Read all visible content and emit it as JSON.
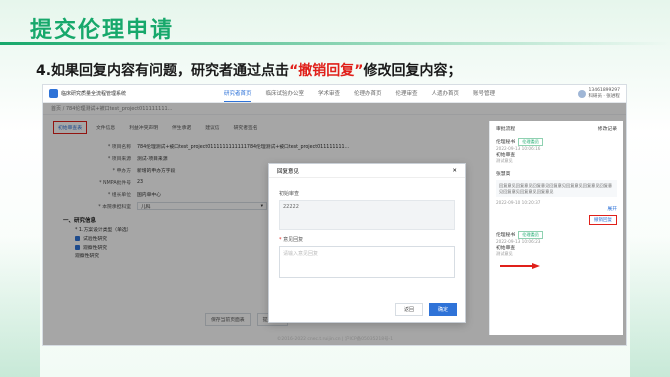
{
  "slide": {
    "title": "提交伦理申请",
    "instruction_prefix": "4.如果回复内容有问题，研究者通过点击",
    "instruction_highlight": "“撤销回复”",
    "instruction_suffix": "修改回复内容；"
  },
  "app": {
    "system_name": "临床研究质量全流程管理系统",
    "nav": [
      "研究者首页",
      "临床试验办公室",
      "学术审查",
      "伦理办首页",
      "伦理审查",
      "人遗办首页",
      "账号管理"
    ],
    "user": {
      "phone": "13461899297",
      "role": "科研员 · 张进程"
    },
    "breadcrumb": "首页 / 784伦理测试+被口test_project011111111...",
    "tabs": [
      "初始审查表",
      "文件信息",
      "利益冲突声明",
      "伴生承诺",
      "建议信",
      "研究者签名"
    ],
    "form": {
      "rows": [
        {
          "label": "* 项目名称",
          "value": "784伦理测试+被口test_project0111111111111784伦理测试+被口test_project011111111..."
        },
        {
          "label": "* 项目来源",
          "value": "测试-项目来源"
        },
        {
          "label": "* 申办方",
          "value": "新增的申办方字段"
        },
        {
          "label": "* NMPA批件号",
          "value": "23"
        },
        {
          "label": "* 组长单位",
          "value": "国内单中心"
        }
      ],
      "select_row": {
        "label": "* 本院承担科室",
        "value": "儿科",
        "second_label": "* 本院"
      },
      "section_title": "一、研究信息",
      "study_type_label": "* 1.方案设计类型（单选）",
      "checkboxes": [
        "试验性研究",
        "观察性研究"
      ],
      "sub_label": "观察性研究"
    },
    "bottom_buttons": [
      "保存当前页面表",
      "提交申请"
    ],
    "right_panel": {
      "title": "审批流程",
      "link": "修改记录",
      "items": [
        {
          "name": "伦理秘书",
          "tag": "伦理委员",
          "time": "2022-09-13 10:06:16",
          "status": "初始审查",
          "note": "测试意见"
        },
        {
          "name": "张慧高",
          "text": "回复意见回复意见回复意见回复意见回复意见回复意见回复意见回复意见回复意见回复意见",
          "time": "2022-09-10 10:20:37",
          "more": "展开"
        },
        {
          "revoke": "撤销回复"
        },
        {
          "name": "伦理秘书",
          "tag": "伦理委员",
          "time": "2022-09-13 10:06:23",
          "status": "初始审查",
          "note": "测试意见"
        }
      ]
    },
    "modal": {
      "title": "回复意见",
      "field1_label": "初始审查",
      "field1_value": "22222",
      "field2_label": "意见回复",
      "field2_placeholder": "请输入意见回复",
      "cancel": "返回",
      "confirm": "确定"
    },
    "footer": "©2016-2022 cnec.t.ruijin.cn | 沪ICP备05035218号-1"
  },
  "colors": {
    "accent": "#2f73d8",
    "brand_green": "#17a86b",
    "highlight_red": "#e0201a"
  }
}
